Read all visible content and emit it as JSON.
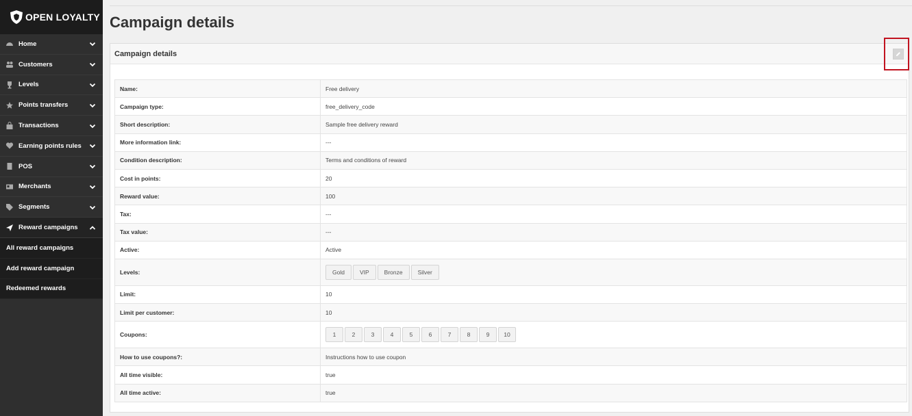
{
  "brand": {
    "name": "OPEN LOYALTY"
  },
  "sidebar": {
    "items": [
      {
        "label": "Home",
        "icon": "dashboard-icon",
        "open": false
      },
      {
        "label": "Customers",
        "icon": "users-icon",
        "open": false
      },
      {
        "label": "Levels",
        "icon": "trophy-icon",
        "open": false
      },
      {
        "label": "Points transfers",
        "icon": "star-icon",
        "open": false
      },
      {
        "label": "Transactions",
        "icon": "bag-icon",
        "open": false
      },
      {
        "label": "Earning points rules",
        "icon": "heart-icon",
        "open": false
      },
      {
        "label": "POS",
        "icon": "pos-icon",
        "open": false
      },
      {
        "label": "Merchants",
        "icon": "id-card-icon",
        "open": false
      },
      {
        "label": "Segments",
        "icon": "tags-icon",
        "open": false
      },
      {
        "label": "Reward campaigns",
        "icon": "send-icon",
        "open": true
      }
    ],
    "subitems": [
      {
        "label": "All reward campaigns"
      },
      {
        "label": "Add reward campaign"
      },
      {
        "label": "Redeemed rewards"
      }
    ]
  },
  "page": {
    "title": "Campaign details"
  },
  "panel": {
    "title": "Campaign details"
  },
  "details": [
    {
      "key": "Name:",
      "value": "Free delivery"
    },
    {
      "key": "Campaign type:",
      "value": "free_delivery_code"
    },
    {
      "key": "Short description:",
      "value": "Sample free delivery reward"
    },
    {
      "key": "More information link:",
      "value": "---"
    },
    {
      "key": "Condition description:",
      "value": "Terms and conditions of reward"
    },
    {
      "key": "Cost in points:",
      "value": "20"
    },
    {
      "key": "Reward value:",
      "value": "100"
    },
    {
      "key": "Tax:",
      "value": "---"
    },
    {
      "key": "Tax value:",
      "value": "---"
    },
    {
      "key": "Active:",
      "value": "Active"
    },
    {
      "key": "Levels:",
      "tags": [
        "Gold",
        "VIP",
        "Bronze",
        "Silver"
      ]
    },
    {
      "key": "Limit:",
      "value": "10"
    },
    {
      "key": "Limit per customer:",
      "value": "10"
    },
    {
      "key": "Coupons:",
      "tags": [
        "1",
        "2",
        "3",
        "4",
        "5",
        "6",
        "7",
        "8",
        "9",
        "10"
      ]
    },
    {
      "key": "How to use coupons?:",
      "value": "Instructions how to use coupon"
    },
    {
      "key": "All time visible:",
      "value": "true"
    },
    {
      "key": "All time active:",
      "value": "true"
    }
  ],
  "colors": {
    "sidebar": "#2f2f2f",
    "highlight": "#c1121f"
  }
}
